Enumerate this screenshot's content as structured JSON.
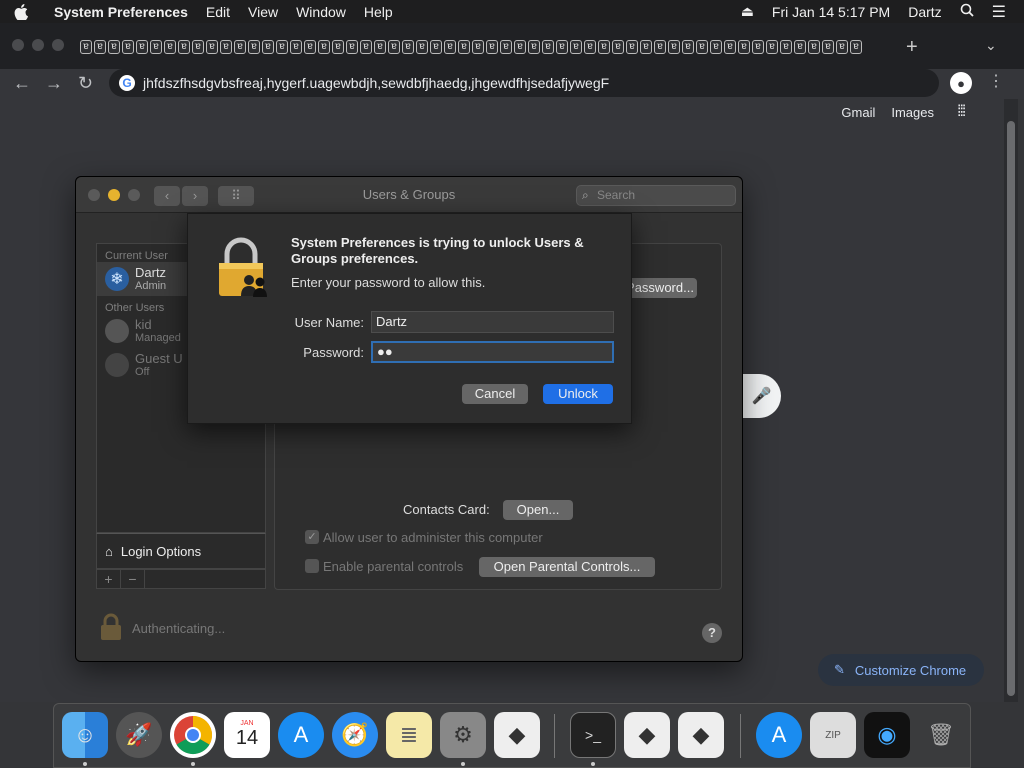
{
  "menubar": {
    "app_name": "System Preferences",
    "items": [
      "Edit",
      "View",
      "Window",
      "Help"
    ],
    "datetime": "Fri Jan 14  5:17 PM",
    "user": "Dartz"
  },
  "chrome": {
    "tab_count_glyph": "ɐ",
    "url": "jhfdszfhsdgvbsfreaj,hygerf.uagewbdjh,sewdbfjhaedg,jhgewdfhjsedafjywegF",
    "links": [
      "Gmail",
      "Images"
    ],
    "customize_label": "Customize Chrome"
  },
  "prefs": {
    "title": "Users & Groups",
    "search_placeholder": "Search",
    "current_user_header": "Current User",
    "other_users_header": "Other Users",
    "users": [
      {
        "name": "Dartz",
        "role": "Admin"
      },
      {
        "name": "kid",
        "role": "Managed"
      },
      {
        "name": "Guest U",
        "role": "Off"
      }
    ],
    "login_options": "Login Options",
    "change_password_btn": "Password...",
    "contacts_card_label": "Contacts Card:",
    "open_btn": "Open...",
    "allow_admin": "Allow user to administer this computer",
    "parental_controls": "Enable parental controls",
    "open_parental_btn": "Open Parental Controls...",
    "status": "Authenticating...",
    "help": "?"
  },
  "dialog": {
    "title": "System Preferences is trying to unlock Users & Groups preferences.",
    "message": "Enter your password to allow this.",
    "username_label": "User Name:",
    "username_value": "Dartz",
    "password_label": "Password:",
    "password_value": "●●",
    "cancel_label": "Cancel",
    "unlock_label": "Unlock"
  },
  "colors": {
    "accent": "#1f6fe6",
    "window_bg": "#323232",
    "lock_gold": "#e0a830"
  }
}
